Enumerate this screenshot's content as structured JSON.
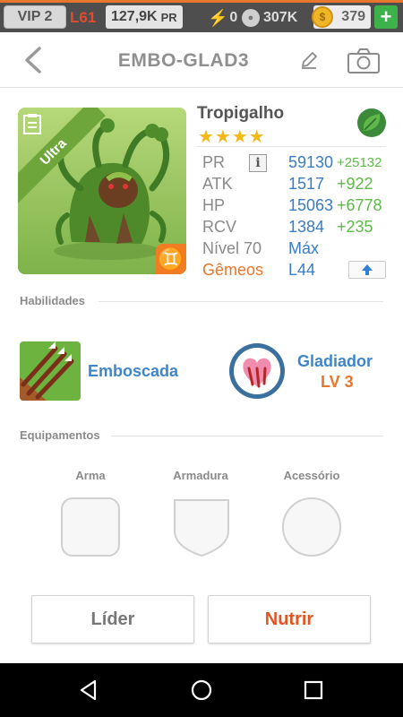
{
  "topbar": {
    "vip": "VIP 2",
    "level": "L61",
    "pr_value": "127,9K",
    "pr_unit": "PR",
    "energy": "0",
    "paws": "307K",
    "coins": "379",
    "add": "+"
  },
  "header": {
    "title": "EMBO-GLAD3"
  },
  "hero": {
    "rarity": "Ultra",
    "name": "Tropigalho",
    "stars": "★★★★",
    "element_icon": "leaf-icon",
    "zodiac_glyph": "♊",
    "info": "i",
    "stats": [
      {
        "label": "PR",
        "value": "59130",
        "bonus": "+25132"
      },
      {
        "label": "ATK",
        "value": "1517",
        "bonus": "+922"
      },
      {
        "label": "HP",
        "value": "15063",
        "bonus": "+6778"
      },
      {
        "label": "RCV",
        "value": "1384",
        "bonus": "+235"
      }
    ],
    "level_label": "Nível 70",
    "level_value": "Máx",
    "sign_label": "Gêmeos",
    "sign_value": "L44"
  },
  "abilities": {
    "title": "Habilidades",
    "skill1": "Emboscada",
    "skill2": "Gladiador",
    "skill2_level": "LV 3"
  },
  "equipment": {
    "title": "Equipamentos",
    "slots": [
      "Arma",
      "Armadura",
      "Acessório"
    ]
  },
  "actions": {
    "leader": "Líder",
    "feed": "Nutrir"
  },
  "colors": {
    "accent_orange": "#e8762c",
    "stat_blue": "#3b7bc4",
    "bonus_green": "#5fb84a",
    "star_gold": "#f4b816"
  }
}
